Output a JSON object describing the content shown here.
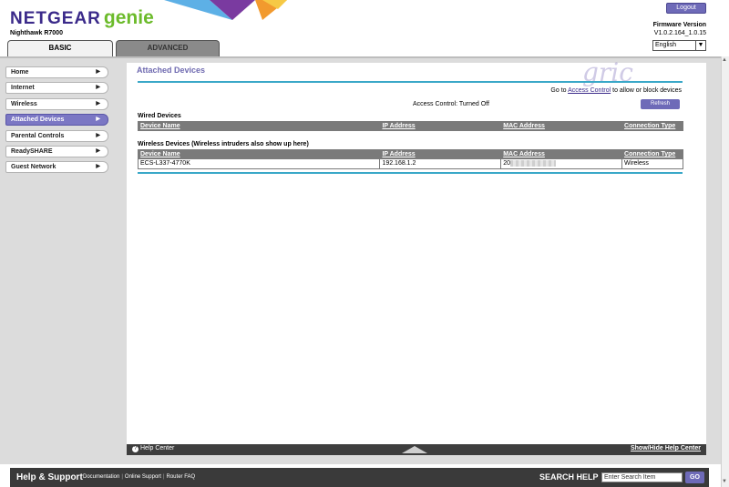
{
  "header": {
    "brand": "NETGEAR",
    "brand_suffix": "genie",
    "model": "Nighthawk R7000",
    "logout_label": "Logout",
    "firmware_label": "Firmware Version",
    "firmware_version": "V1.0.2.164_1.0.15",
    "language": "English"
  },
  "tabs": {
    "basic": "BASIC",
    "advanced": "ADVANCED"
  },
  "sidebar": {
    "items": [
      {
        "label": "Home"
      },
      {
        "label": "Internet"
      },
      {
        "label": "Wireless"
      },
      {
        "label": "Attached Devices"
      },
      {
        "label": "Parental Controls"
      },
      {
        "label": "ReadySHARE"
      },
      {
        "label": "Guest Network"
      }
    ]
  },
  "main": {
    "title": "Attached Devices",
    "goto_prefix": "Go to",
    "goto_link": "Access Control",
    "goto_suffix": "to allow or block devices",
    "refresh_label": "Refresh",
    "access_control_status": "Access Control: Turned Off",
    "wired_title": "Wired Devices",
    "wireless_title": "Wireless Devices (Wireless intruders also show up here)",
    "columns": {
      "name": "Device Name",
      "ip": "IP Address",
      "mac": "MAC Address",
      "type": "Connection Type"
    },
    "wireless_rows": [
      {
        "name": "ECS-L337-4770K",
        "ip": "192.168.1.2",
        "mac": "20",
        "type": "Wireless"
      }
    ]
  },
  "help_bar": {
    "help_center": "Help Center",
    "toggle": "Show/Hide Help Center"
  },
  "footer": {
    "title": "Help & Support",
    "links": [
      "Documentation",
      "Online Support",
      "Router FAQ"
    ],
    "search_label": "SEARCH HELP",
    "search_placeholder": "Enter Search Item",
    "go_label": "GO"
  },
  "watermark": "gric",
  "colors": {
    "brand": "#3b2a8a",
    "accent": "#6e6ab8",
    "genie": "#6cbb2b",
    "rule": "#3aa8c8"
  }
}
